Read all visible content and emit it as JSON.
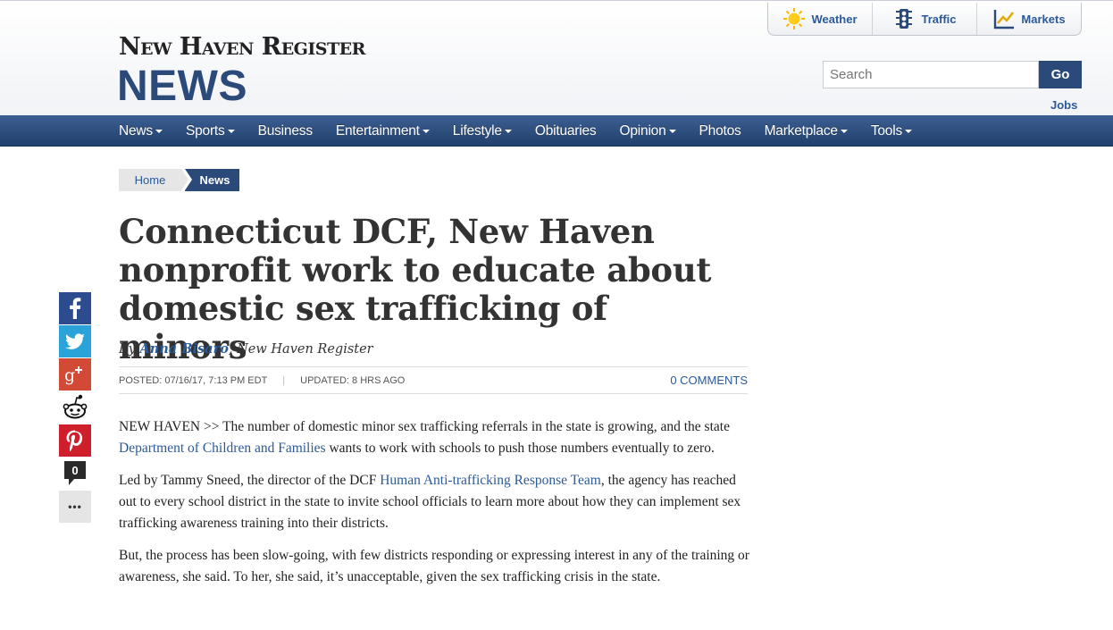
{
  "brand": {
    "top": "New Haven Register",
    "section": "NEWS"
  },
  "quicklinks": [
    {
      "label": "Weather",
      "icon": "sun-icon"
    },
    {
      "label": "Traffic",
      "icon": "traffic-light-icon"
    },
    {
      "label": "Markets",
      "icon": "chart-icon"
    }
  ],
  "search": {
    "placeholder": "Search",
    "button": "Go"
  },
  "jobs_label": "Jobs",
  "nav": [
    {
      "label": "News",
      "dropdown": true
    },
    {
      "label": "Sports",
      "dropdown": true
    },
    {
      "label": "Business",
      "dropdown": false
    },
    {
      "label": "Entertainment",
      "dropdown": true
    },
    {
      "label": "Lifestyle",
      "dropdown": true
    },
    {
      "label": "Obituaries",
      "dropdown": false
    },
    {
      "label": "Opinion",
      "dropdown": true
    },
    {
      "label": "Photos",
      "dropdown": false
    },
    {
      "label": "Marketplace",
      "dropdown": true
    },
    {
      "label": "Tools",
      "dropdown": true
    }
  ],
  "breadcrumb": {
    "home": "Home",
    "current": "News"
  },
  "article": {
    "headline": "Connecticut DCF, New Haven nonprofit work to educate about domestic sex trafficking of minors",
    "byline_prefix": "By ",
    "author": "Anna Bisaro",
    "byline_suffix": ", New Haven Register",
    "posted": "POSTED: 07/16/17, 7:13 PM EDT",
    "updated": "UPDATED: 8 HRS AGO",
    "comments": "0 COMMENTS",
    "p1a": "NEW HAVEN >> The number of domestic minor sex trafficking referrals in the state is growing, and the state ",
    "p1link": "Department of Children and Families",
    "p1b": " wants to work with schools to push those numbers eventually to zero.",
    "p2a": "Led by Tammy Sneed, the director of the DCF ",
    "p2link": "Human Anti-trafficking Response Team",
    "p2b": ", the agency has reached out to every school district in the state to invite school officials to learn more about how they can implement sex trafficking awareness training into their districts.",
    "p3": "But, the process has been slow-going, with few districts responding or expressing interest in any of the training or awareness, she said. To her, she said, it’s unacceptable, given the sex trafficking crisis in the state."
  },
  "share": {
    "comment_count": "0",
    "more": "•••"
  },
  "colors": {
    "brand_blue": "#2b4a7a",
    "link_blue": "#2b5a99"
  }
}
